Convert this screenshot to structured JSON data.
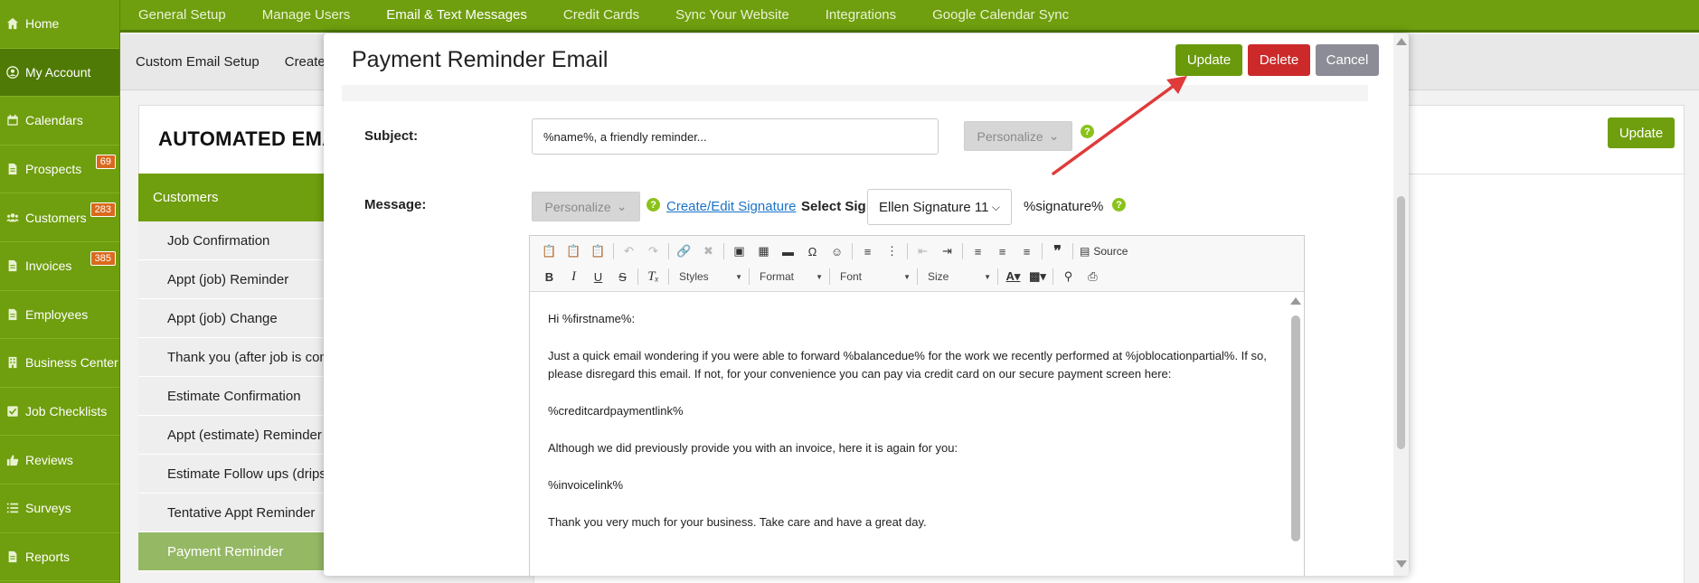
{
  "sidebar": {
    "items": [
      {
        "label": "Home",
        "icon": "home-icon"
      },
      {
        "label": "My Account",
        "icon": "user-circle-icon",
        "active": true
      },
      {
        "label": "Calendars",
        "icon": "calendar-icon"
      },
      {
        "label": "Prospects",
        "icon": "document-icon",
        "badge": "69"
      },
      {
        "label": "Customers",
        "icon": "users-icon",
        "badge": "283"
      },
      {
        "label": "Invoices",
        "icon": "document-icon",
        "badge": "385"
      },
      {
        "label": "Employees",
        "icon": "document-icon"
      },
      {
        "label": "Business Center",
        "icon": "building-icon"
      },
      {
        "label": "Job Checklists",
        "icon": "checkbox-icon"
      },
      {
        "label": "Reviews",
        "icon": "thumbs-up-icon"
      },
      {
        "label": "Surveys",
        "icon": "list-icon"
      },
      {
        "label": "Reports",
        "icon": "document-icon"
      }
    ]
  },
  "topnav": {
    "items": [
      "General Setup",
      "Manage Users",
      "Email & Text Messages",
      "Credit Cards",
      "Sync Your Website",
      "Integrations",
      "Google Calendar Sync"
    ],
    "active": "Email & Text Messages"
  },
  "subnav": {
    "items": [
      "Custom Email Setup",
      "Create"
    ]
  },
  "background": {
    "title": "AUTOMATED EMA",
    "update_label": "Update",
    "list_header": "Customers",
    "list_items": [
      "Job Confirmation",
      "Appt (job) Reminder",
      "Appt (job) Change",
      "Thank you (after job is com",
      "Estimate Confirmation",
      "Appt (estimate) Reminder",
      "Estimate Follow ups (drips)",
      "Tentative Appt Reminder",
      "Payment Reminder"
    ],
    "active_item": "Payment Reminder"
  },
  "modal": {
    "title": "Payment Reminder Email",
    "buttons": {
      "update": "Update",
      "delete": "Delete",
      "cancel": "Cancel"
    },
    "subject_label": "Subject:",
    "subject_value": "%name%, a friendly reminder...",
    "personalize_label": "Personalize",
    "message_label": "Message:",
    "create_signature_link": "Create/Edit Signature",
    "select_sig_label": "Select Sig",
    "signature_selected": "Ellen Signature 11",
    "signature_token": "%signature%",
    "help_glyph": "?",
    "toolbar": {
      "styles": "Styles",
      "format": "Format",
      "font": "Font",
      "size": "Size",
      "source": "Source"
    },
    "body_paragraphs": [
      "Hi %firstname%:",
      "Just a quick email wondering if you were able to forward %balancedue% for the work we recently performed at %joblocationpartial%. If so, please disregard this email. If not, for your convenience you can pay via credit card on our secure payment screen here:",
      "%creditcardpaymentlink%",
      "Although we did previously provide you with an invoice, here it is again for you:",
      "%invoicelink%",
      "Thank you very much for your business. Take care and have a great day."
    ]
  },
  "colors": {
    "brand_green": "#6f9e0e",
    "delete_red": "#cc2a2a",
    "cancel_gray": "#8c8c96",
    "badge_orange": "#d96a1d",
    "annotation_arrow": "#e03a3a"
  }
}
